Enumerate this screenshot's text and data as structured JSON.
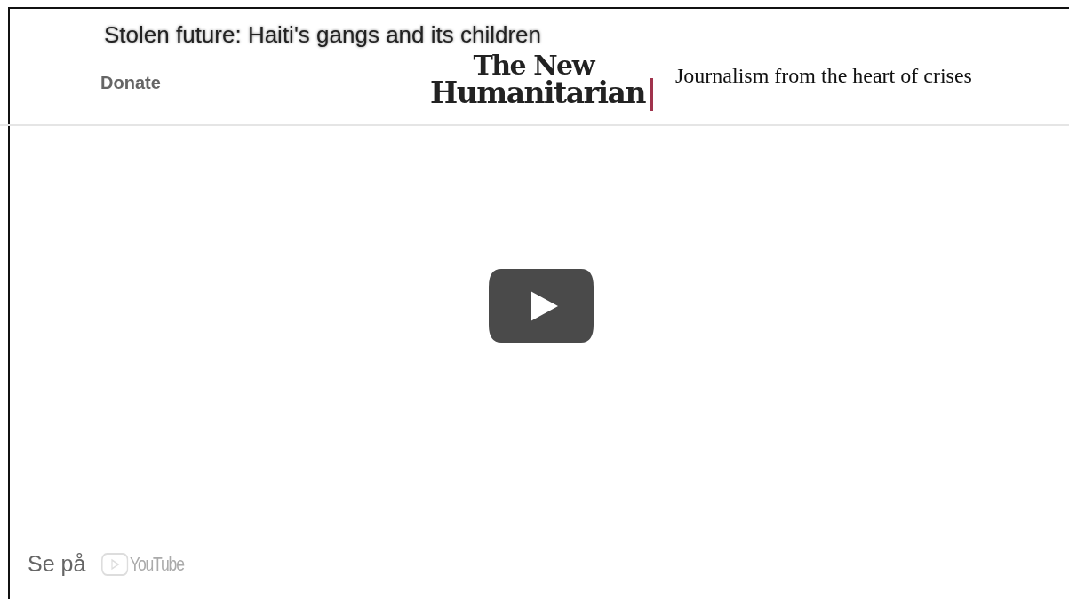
{
  "header": {
    "donate": "Donate",
    "logo": [
      "The New",
      "Humanitarian"
    ],
    "tagline": "Journalism from the heart of crises"
  },
  "video": {
    "title": "Stolen future: Haiti's gangs and its children",
    "watch_on": "Se på",
    "platform": "YouTube"
  }
}
